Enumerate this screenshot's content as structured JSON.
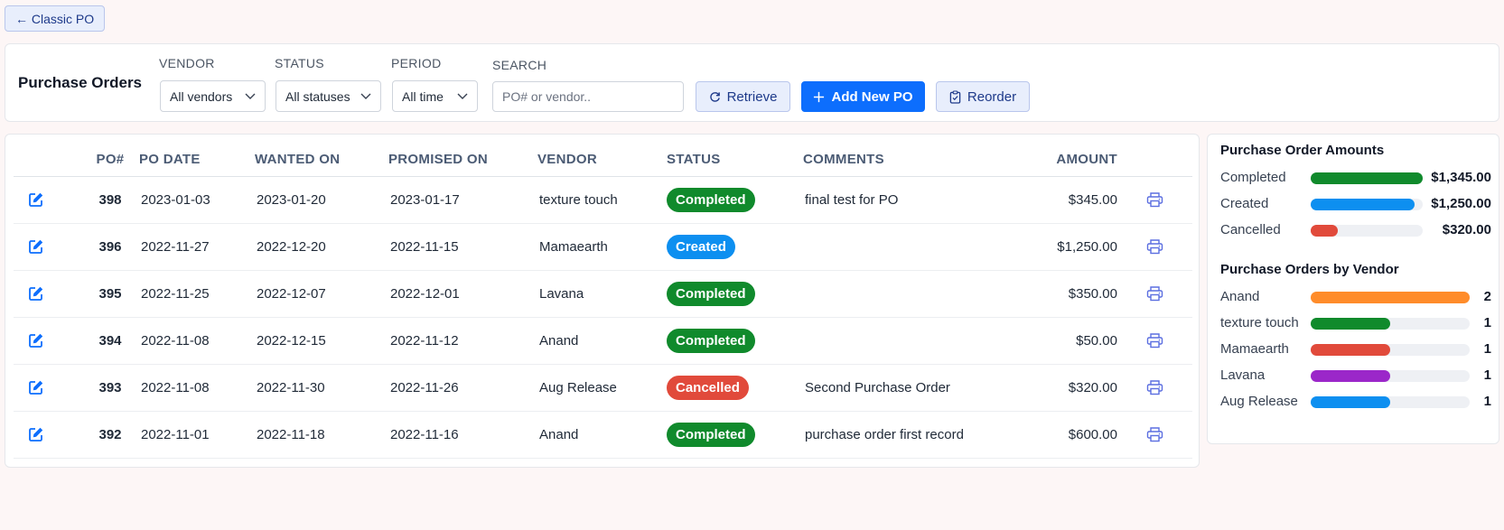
{
  "back_button": {
    "label": "← Classic PO"
  },
  "toolbar": {
    "title": "Purchase Orders",
    "filters": {
      "vendor": {
        "label": "VENDOR",
        "value": "All vendors"
      },
      "status": {
        "label": "STATUS",
        "value": "All statuses"
      },
      "period": {
        "label": "PERIOD",
        "value": "All time"
      },
      "search": {
        "label": "SEARCH",
        "placeholder": "PO# or vendor.."
      }
    },
    "buttons": {
      "retrieve": {
        "label": "Retrieve",
        "icon": "refresh-icon"
      },
      "add_new": {
        "label": "Add New PO",
        "icon": "plus-icon"
      },
      "reorder": {
        "label": "Reorder",
        "icon": "clipboard-icon"
      }
    }
  },
  "table": {
    "columns": [
      "PO#",
      "PO DATE",
      "WANTED ON",
      "PROMISED ON",
      "VENDOR",
      "STATUS",
      "COMMENTS",
      "AMOUNT"
    ],
    "rows": [
      {
        "po": "398",
        "po_date": "2023-01-03",
        "wanted_on": "2023-01-20",
        "promised_on": "2023-01-17",
        "vendor": "texture touch",
        "status": "Completed",
        "comments": "final test for PO",
        "amount": "$345.00"
      },
      {
        "po": "396",
        "po_date": "2022-11-27",
        "wanted_on": "2022-12-20",
        "promised_on": "2022-11-15",
        "vendor": "Mamaearth",
        "status": "Created",
        "comments": "",
        "amount": "$1,250.00"
      },
      {
        "po": "395",
        "po_date": "2022-11-25",
        "wanted_on": "2022-12-07",
        "promised_on": "2022-12-01",
        "vendor": "Lavana",
        "status": "Completed",
        "comments": "",
        "amount": "$350.00"
      },
      {
        "po": "394",
        "po_date": "2022-11-08",
        "wanted_on": "2022-12-15",
        "promised_on": "2022-11-12",
        "vendor": "Anand",
        "status": "Completed",
        "comments": "",
        "amount": "$50.00"
      },
      {
        "po": "393",
        "po_date": "2022-11-08",
        "wanted_on": "2022-11-30",
        "promised_on": "2022-11-26",
        "vendor": "Aug Release",
        "status": "Cancelled",
        "comments": "Second Purchase Order",
        "amount": "$320.00"
      },
      {
        "po": "392",
        "po_date": "2022-11-01",
        "wanted_on": "2022-11-18",
        "promised_on": "2022-11-16",
        "vendor": "Anand",
        "status": "Completed",
        "comments": "purchase order first record",
        "amount": "$600.00"
      }
    ]
  },
  "status_colors": {
    "Completed": "#108a2c",
    "Created": "#0d8ff0",
    "Cancelled": "#e14a3b"
  },
  "sidebar": {
    "amounts": {
      "title": "Purchase Order Amounts",
      "items": [
        {
          "label": "Completed",
          "value": "$1,345.00",
          "fraction": 1.0,
          "color": "#108a2c"
        },
        {
          "label": "Created",
          "value": "$1,250.00",
          "fraction": 0.93,
          "color": "#0d8ff0"
        },
        {
          "label": "Cancelled",
          "value": "$320.00",
          "fraction": 0.24,
          "color": "#e14a3b"
        }
      ]
    },
    "vendors": {
      "title": "Purchase Orders by Vendor",
      "items": [
        {
          "label": "Anand",
          "value": "2",
          "fraction": 1.0,
          "color": "#ff8c2a"
        },
        {
          "label": "texture touch",
          "value": "1",
          "fraction": 0.5,
          "color": "#108a2c"
        },
        {
          "label": "Mamaearth",
          "value": "1",
          "fraction": 0.5,
          "color": "#e14a3b"
        },
        {
          "label": "Lavana",
          "value": "1",
          "fraction": 0.5,
          "color": "#9b27c9"
        },
        {
          "label": "Aug Release",
          "value": "1",
          "fraction": 0.5,
          "color": "#0d8ff0"
        }
      ]
    }
  }
}
